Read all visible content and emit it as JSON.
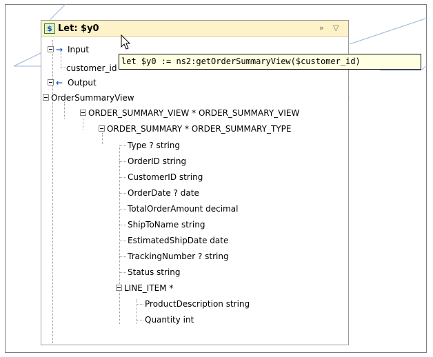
{
  "node": {
    "title": "Let: $y0",
    "icon": "let-node-icon",
    "collapse_glyph": "»",
    "pin_glyph": "▽"
  },
  "tree": {
    "input_label": "Input",
    "input_child": "customer_id",
    "output_label": "Output",
    "root": "OrderSummaryView",
    "view": "ORDER_SUMMARY_VIEW * ORDER_SUMMARY_VIEW",
    "summary": "ORDER_SUMMARY * ORDER_SUMMARY_TYPE",
    "fields": [
      "Type ? string",
      "OrderID string",
      "CustomerID string",
      "OrderDate ? date",
      "TotalOrderAmount decimal",
      "ShipToName string",
      "EstimatedShipDate date",
      "TrackingNumber ? string",
      "Status string"
    ],
    "line_item": "LINE_ITEM *",
    "line_item_fields": [
      "ProductDescription string",
      "Quantity int"
    ]
  },
  "tooltip": {
    "text": "let $y0 := ns2:getOrderSummaryView($customer_id)"
  },
  "colors": {
    "title_bg": "#fdf2c8",
    "tooltip_bg": "#ffffe1",
    "arrow": "#1a56c8"
  }
}
